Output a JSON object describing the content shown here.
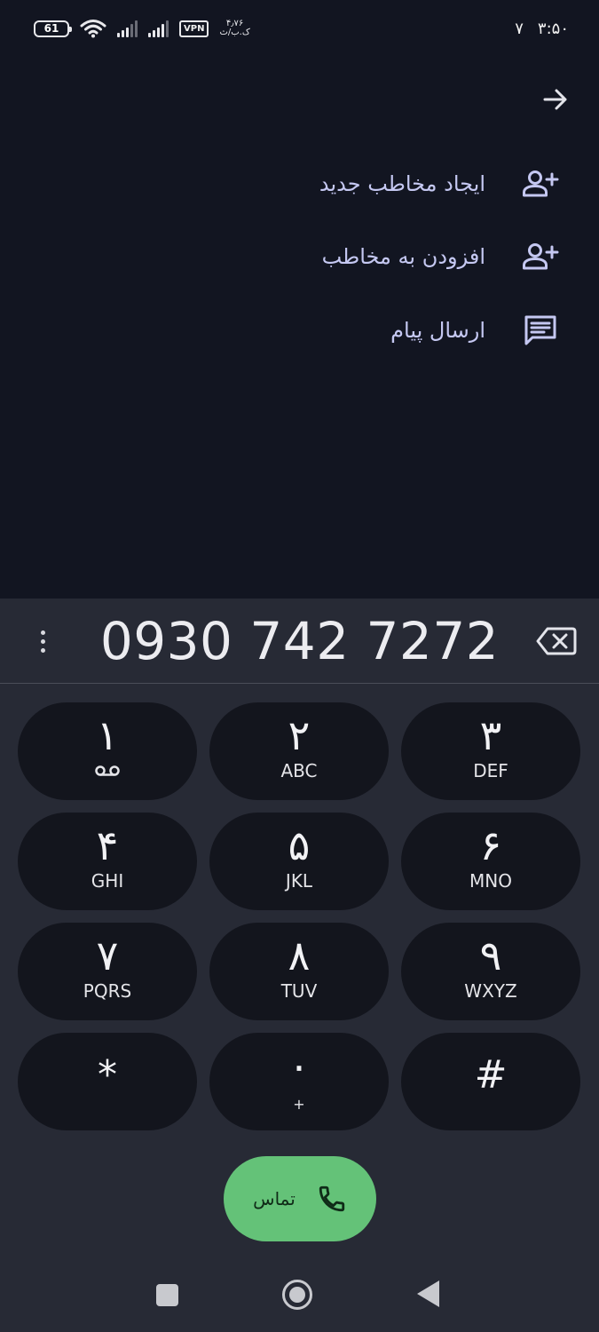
{
  "status_bar": {
    "battery": "61",
    "vpn": "VPN",
    "speed_value": "۴٫۷۶",
    "speed_unit": "ک.ب/ث",
    "indicator": "۷",
    "time": "۳:۵۰"
  },
  "menu": {
    "items": [
      {
        "label": "ایجاد مخاطب جدید",
        "icon": "person-add-icon"
      },
      {
        "label": "افزودن به مخاطب",
        "icon": "person-add-icon"
      },
      {
        "label": "ارسال پیام",
        "icon": "message-icon"
      }
    ]
  },
  "dialer": {
    "number": "0930 742 7272",
    "keys": [
      {
        "digit": "۱",
        "letters": ""
      },
      {
        "digit": "۲",
        "letters": "ABC"
      },
      {
        "digit": "۳",
        "letters": "DEF"
      },
      {
        "digit": "۴",
        "letters": "GHI"
      },
      {
        "digit": "۵",
        "letters": "JKL"
      },
      {
        "digit": "۶",
        "letters": "MNO"
      },
      {
        "digit": "۷",
        "letters": "PQRS"
      },
      {
        "digit": "۸",
        "letters": "TUV"
      },
      {
        "digit": "۹",
        "letters": "WXYZ"
      },
      {
        "digit": "*",
        "letters": ""
      },
      {
        "digit": "۰",
        "letters": "+"
      },
      {
        "digit": "#",
        "letters": ""
      }
    ],
    "call_label": "تماس"
  },
  "colors": {
    "background": "#121521",
    "dialer_panel": "#272a35",
    "key_background": "#13151d",
    "accent_text": "#c5c8f2",
    "call_green": "#64c278"
  }
}
